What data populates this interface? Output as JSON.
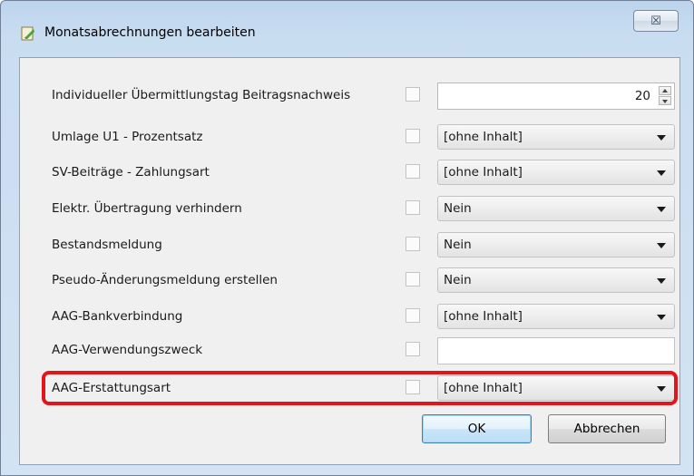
{
  "window": {
    "title": "Monatsabrechnungen bearbeiten",
    "close_glyph": "☒",
    "icon": "app-edit-icon"
  },
  "rows": [
    {
      "label": "Individueller Übermittlungstag Beitragsnachweis",
      "control": "spin",
      "value": "20"
    },
    {
      "label": "Umlage U1 - Prozentsatz",
      "control": "combo",
      "value": "[ohne Inhalt]"
    },
    {
      "label": "SV-Beiträge - Zahlungsart",
      "control": "combo",
      "value": "[ohne Inhalt]"
    },
    {
      "label": "Elektr. Übertragung verhindern",
      "control": "combo",
      "value": "Nein"
    },
    {
      "label": "Bestandsmeldung",
      "control": "combo",
      "value": "Nein"
    },
    {
      "label": "Pseudo-Änderungsmeldung erstellen",
      "control": "combo",
      "value": "Nein"
    },
    {
      "label": "AAG-Bankverbindung",
      "control": "combo",
      "value": "[ohne Inhalt]"
    },
    {
      "label": "AAG-Verwendungszweck",
      "control": "text",
      "value": ""
    },
    {
      "label": "AAG-Erstattungsart",
      "control": "combo",
      "value": "[ohne Inhalt]"
    }
  ],
  "buttons": {
    "ok": "OK",
    "cancel": "Abbrechen"
  },
  "colors": {
    "highlight": "#e3151b",
    "dialog_bg": "#f0f0f0",
    "frame": "#c9ddf1"
  }
}
